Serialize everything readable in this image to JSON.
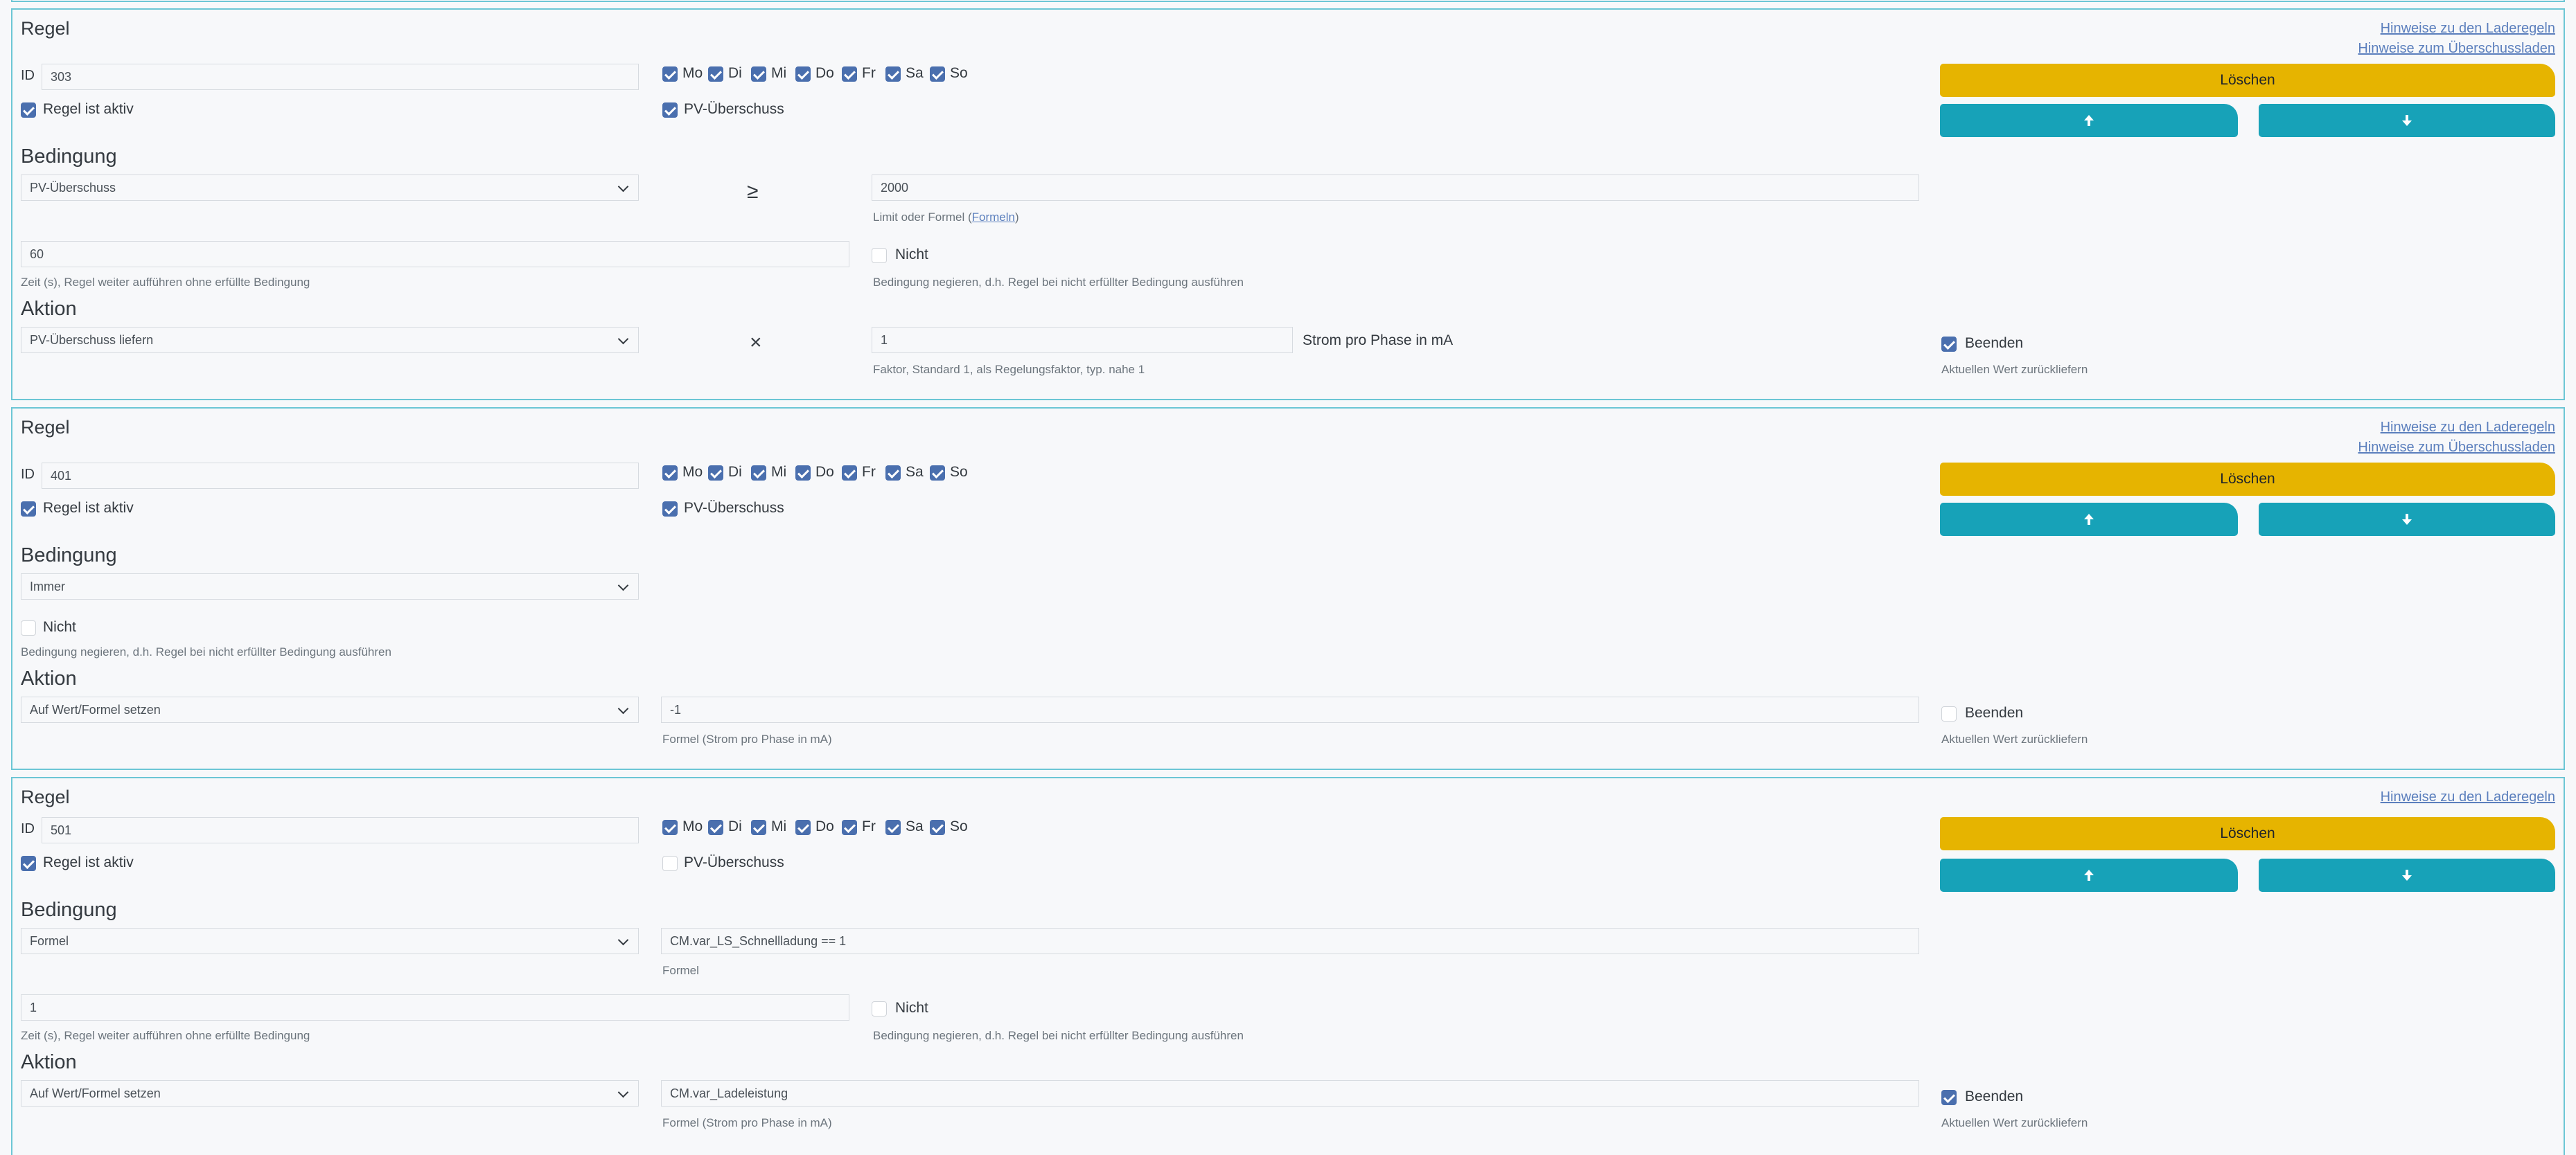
{
  "links": {
    "laderegeln": "Hinweise zu den Laderegeln",
    "ueberschuss": "Hinweise zum Überschussladen"
  },
  "labels": {
    "regel": "Regel",
    "id": "ID",
    "aktiv": "Regel ist aktiv",
    "pv": "PV-Überschuss",
    "bedingung": "Bedingung",
    "aktion": "Aktion",
    "nicht": "Nicht",
    "beenden": "Beenden",
    "loeschen": "Löschen",
    "zeit_help": "Zeit (s), Regel weiter aufführen ohne erfüllte Bedingung",
    "nicht_help": "Bedingung negieren, d.h. Regel bei nicht erfüllter Bedingung ausführen",
    "beenden_help": "Aktuellen Wert zurückliefern",
    "limit_help_prefix": "Limit oder Formel (",
    "limit_help_link": "Formeln",
    "limit_help_suffix": ")",
    "faktor_help": "Faktor, Standard 1, als Regelungsfaktor, typ. nahe 1",
    "strom_label": "Strom pro Phase in mA",
    "formel_help": "Formel",
    "formel_strom_help": "Formel (Strom pro Phase in mA)"
  },
  "days": [
    "Mo",
    "Di",
    "Mi",
    "Do",
    "Fr",
    "Sa",
    "So"
  ],
  "operators": {
    "ge": "≥",
    "times": "×"
  },
  "icons": {
    "up": "arrow-up-icon",
    "down": "arrow-down-icon",
    "chevron": "chevron-down-icon",
    "check": "check-icon"
  },
  "colors": {
    "border": "#6cc6d5",
    "delete": "#e6b400",
    "arrow": "#17a2b8",
    "checkbox": "#4a6fae",
    "link": "#5b7fbd"
  },
  "rules": [
    {
      "id": "303",
      "aktiv": true,
      "pv": true,
      "days": [
        true,
        true,
        true,
        true,
        true,
        true,
        true
      ],
      "condition": "PV-Überschuss",
      "limit": "2000",
      "zeit": "60",
      "nicht": false,
      "action": "PV-Überschuss liefern",
      "faktor": "1",
      "beenden": true
    },
    {
      "id": "401",
      "aktiv": true,
      "pv": true,
      "days": [
        true,
        true,
        true,
        true,
        true,
        true,
        true
      ],
      "condition": "Immer",
      "nicht": false,
      "action": "Auf Wert/Formel setzen",
      "value": "-1",
      "beenden": false
    },
    {
      "id": "501",
      "aktiv": true,
      "pv": false,
      "days": [
        true,
        true,
        true,
        true,
        true,
        true,
        true
      ],
      "condition": "Formel",
      "formel": "CM.var_LS_Schnellladung == 1",
      "zeit": "1",
      "nicht": false,
      "action": "Auf Wert/Formel setzen",
      "value": "CM.var_Ladeleistung",
      "beenden": true
    }
  ]
}
